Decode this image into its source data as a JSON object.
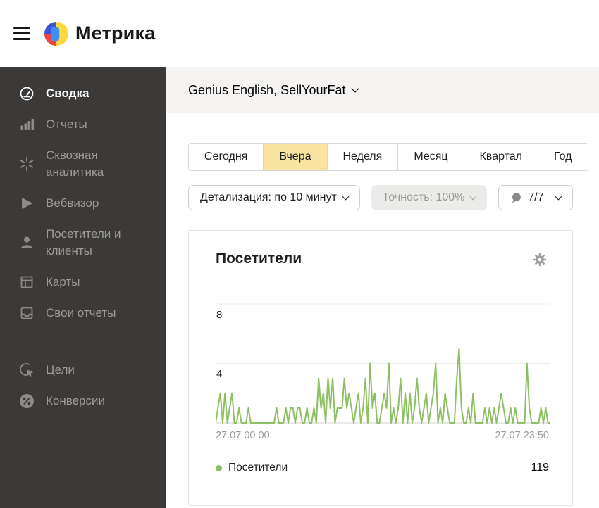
{
  "topbar": {
    "logo_text": "Метрика"
  },
  "brand_colors": {
    "yellow": "#ffd93b",
    "blue_dark": "#3b55d6",
    "blue_light": "#3e8ef5",
    "red": "#ee4444"
  },
  "sidebar": {
    "sections": [
      {
        "items": [
          {
            "label": "Сводка",
            "icon": "gauge-icon",
            "active": true
          },
          {
            "label": "Отчеты",
            "icon": "bar-chart-icon",
            "active": false
          },
          {
            "label": "Сквозная аналитика",
            "icon": "spark-icon",
            "active": false
          },
          {
            "label": "Вебвизор",
            "icon": "play-icon",
            "active": false
          },
          {
            "label": "Посетители и клиенты",
            "icon": "person-icon",
            "active": false
          },
          {
            "label": "Карты",
            "icon": "layout-icon",
            "active": false
          },
          {
            "label": "Свои отчеты",
            "icon": "tray-icon",
            "active": false
          }
        ]
      },
      {
        "items": [
          {
            "label": "Цели",
            "icon": "goal-icon",
            "active": false
          },
          {
            "label": "Конверсии",
            "icon": "percent-icon",
            "active": false
          }
        ]
      }
    ]
  },
  "counter_header": {
    "title": "Genius English, SellYourFat"
  },
  "period_tabs": {
    "selected_index": 1,
    "items": [
      {
        "label": "Сегодня"
      },
      {
        "label": "Вчера"
      },
      {
        "label": "Неделя"
      },
      {
        "label": "Месяц"
      },
      {
        "label": "Квартал"
      },
      {
        "label": "Год"
      }
    ]
  },
  "filters": {
    "granularity_label": "Детализация: по 10 минут",
    "accuracy_label": "Точность: 100%",
    "comments_label": "7/7"
  },
  "widget": {
    "title": "Посетители",
    "y_ticks": {
      "top": "8",
      "mid": "4"
    },
    "x_axis": {
      "start": "27.07 00:00",
      "end": "27.07 23:50"
    },
    "legend": {
      "label": "Посетители",
      "value": "119"
    }
  },
  "chart_data": {
    "type": "line",
    "title": "Посетители",
    "x_start": "27.07 00:00",
    "x_end": "27.07 23:50",
    "x_interval": "по 10 минут",
    "ylim": [
      0,
      8
    ],
    "y_gridlines": [
      4,
      8
    ],
    "line_color": "#8dc063",
    "legend_position": "bottom",
    "series": [
      {
        "name": "Посетители",
        "total": 119,
        "values": [
          0,
          1,
          2,
          0,
          2,
          0,
          1,
          2,
          0,
          0,
          1,
          0,
          0,
          0,
          1,
          0,
          0,
          0,
          0,
          0,
          0,
          0,
          0,
          0,
          0,
          0,
          1,
          0,
          0,
          0,
          1,
          0,
          1,
          1,
          0,
          1,
          1,
          0,
          0,
          1,
          0,
          0,
          1,
          0,
          3,
          1,
          2,
          0,
          3,
          1,
          3,
          0,
          1,
          1,
          1,
          3,
          1,
          2,
          1,
          0,
          1,
          2,
          0,
          1,
          3,
          0,
          4,
          1,
          2,
          0,
          0,
          1,
          2,
          1,
          4,
          0,
          1,
          0,
          1,
          3,
          0,
          2,
          0,
          2,
          0,
          1,
          3,
          1,
          0,
          1,
          2,
          0,
          1,
          2,
          4,
          0,
          1,
          0,
          2,
          1,
          0,
          0,
          0,
          3,
          5,
          1,
          0,
          0,
          1,
          0,
          2,
          0,
          0,
          0,
          0,
          1,
          0,
          1,
          0,
          1,
          0,
          1,
          2,
          1,
          0,
          0,
          1,
          0,
          1,
          0,
          0,
          0,
          0,
          4,
          1,
          0,
          0,
          0,
          0,
          1,
          0,
          1,
          0,
          0
        ]
      }
    ]
  }
}
